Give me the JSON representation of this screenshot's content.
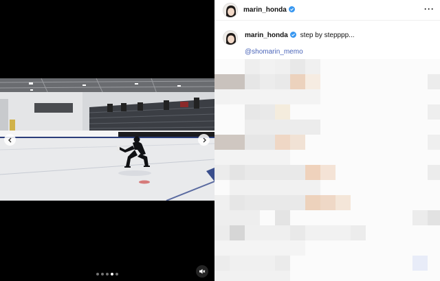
{
  "post": {
    "author": "marin_honda",
    "caption": "step by stepppp...",
    "mention": "@shomarin_memo"
  },
  "media": {
    "slide_count": 5,
    "active_slide": 4
  },
  "colors": {
    "verified": "#3897f0",
    "link": "#4963b8",
    "background": "#ffffff",
    "media_background": "#000000"
  },
  "icons": [
    "chevron-left-icon",
    "chevron-right-icon",
    "mute-icon",
    "verified-badge-icon",
    "more-options-icon"
  ]
}
